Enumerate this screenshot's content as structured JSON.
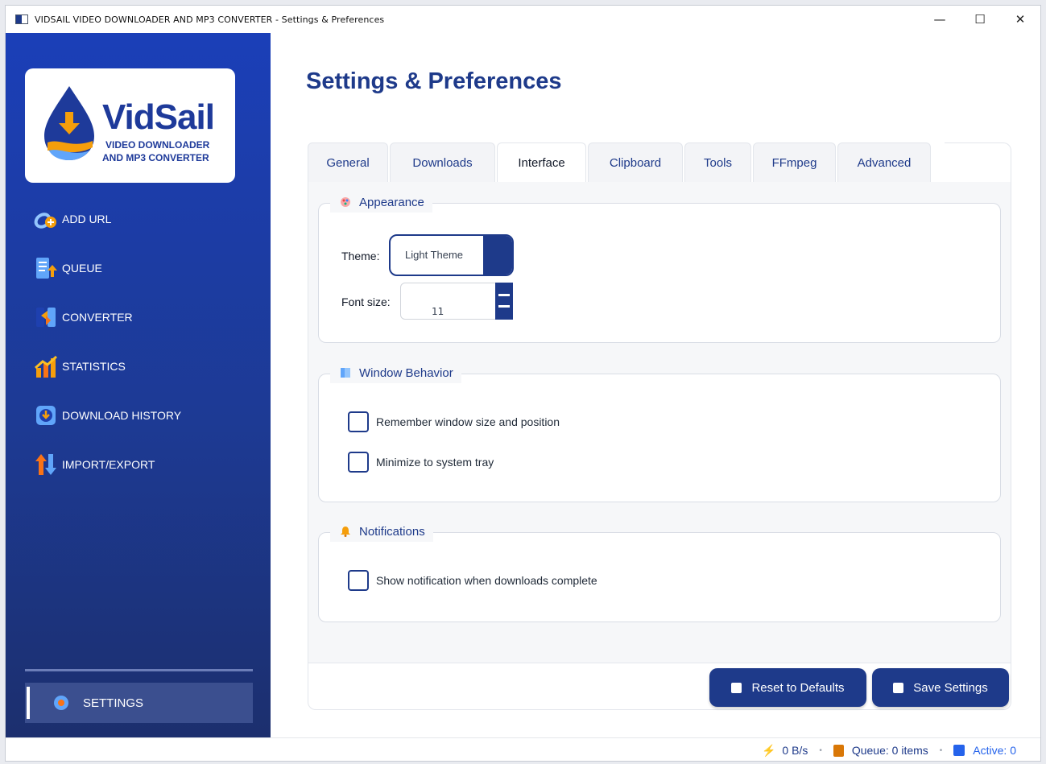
{
  "window": {
    "title": "VIDSAIL VIDEO DOWNLOADER AND MP3 CONVERTER - Settings & Preferences",
    "controls": {
      "minimize": "—",
      "maximize": "☐",
      "close": "✕"
    }
  },
  "logo": {
    "title": "VidSail",
    "subtitle_line1": "VIDEO DOWNLOADER",
    "subtitle_line2": "AND MP3 CONVERTER"
  },
  "sidebar": {
    "items": [
      {
        "label": "ADD URL",
        "icon": "link-add-icon"
      },
      {
        "label": "QUEUE",
        "icon": "queue-icon"
      },
      {
        "label": "CONVERTER",
        "icon": "converter-icon"
      },
      {
        "label": "STATISTICS",
        "icon": "statistics-icon"
      },
      {
        "label": "DOWNLOAD HISTORY",
        "icon": "history-icon"
      },
      {
        "label": "IMPORT/EXPORT",
        "icon": "import-export-icon"
      }
    ],
    "settings_label": "SETTINGS"
  },
  "page": {
    "title": "Settings & Preferences"
  },
  "tabs": [
    {
      "label": "General"
    },
    {
      "label": "Downloads"
    },
    {
      "label": "Interface"
    },
    {
      "label": "Clipboard"
    },
    {
      "label": "Tools"
    },
    {
      "label": "FFmpeg"
    },
    {
      "label": "Advanced"
    }
  ],
  "appearance": {
    "legend": "Appearance",
    "theme_label": "Theme:",
    "theme_value": "Light Theme",
    "font_size_label": "Font size:",
    "font_size_value": "11"
  },
  "window_behavior": {
    "legend": "Window Behavior",
    "remember_label": "Remember window size and position",
    "remember_checked": false,
    "minimize_label": "Minimize to system tray",
    "minimize_checked": false
  },
  "notifications": {
    "legend": "Notifications",
    "show_label": "Show notification when downloads complete",
    "show_checked": false
  },
  "buttons": {
    "reset": "Reset to Defaults",
    "save": "Save Settings"
  },
  "status": {
    "speed": "0 B/s",
    "queue": "Queue: 0 items",
    "active": "Active: 0",
    "separator": "•"
  },
  "colors": {
    "accent": "#1e3a8a",
    "sidebar_top": "#1b3fb8",
    "sidebar_bottom": "#1c2f6e",
    "speed": "#1e3a8a",
    "active": "#2563eb"
  }
}
